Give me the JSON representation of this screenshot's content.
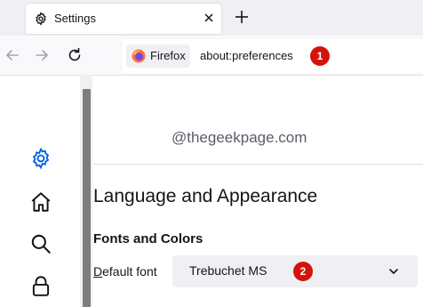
{
  "tab": {
    "title": "Settings"
  },
  "urlbar": {
    "identity_label": "Firefox",
    "url": "about:preferences",
    "callout": "1"
  },
  "content": {
    "watermark": "@thegeekpage.com",
    "section_title": "Language and Appearance",
    "subsection_title": "Fonts and Colors",
    "default_font_label_first": "D",
    "default_font_label_rest": "efault font",
    "default_font_value": "Trebuchet MS",
    "callout": "2"
  },
  "sidebar": {
    "items": [
      {
        "icon": "gear-icon",
        "label": "General"
      },
      {
        "icon": "home-icon",
        "label": "Home"
      },
      {
        "icon": "search-icon",
        "label": "Search"
      },
      {
        "icon": "lock-icon",
        "label": "Privacy & Security"
      }
    ]
  },
  "colors": {
    "accent": "#0061e0",
    "callout_badge": "#d4130f",
    "tabbar_bg": "#f0f0f4",
    "select_bg": "#f0f0f4"
  }
}
